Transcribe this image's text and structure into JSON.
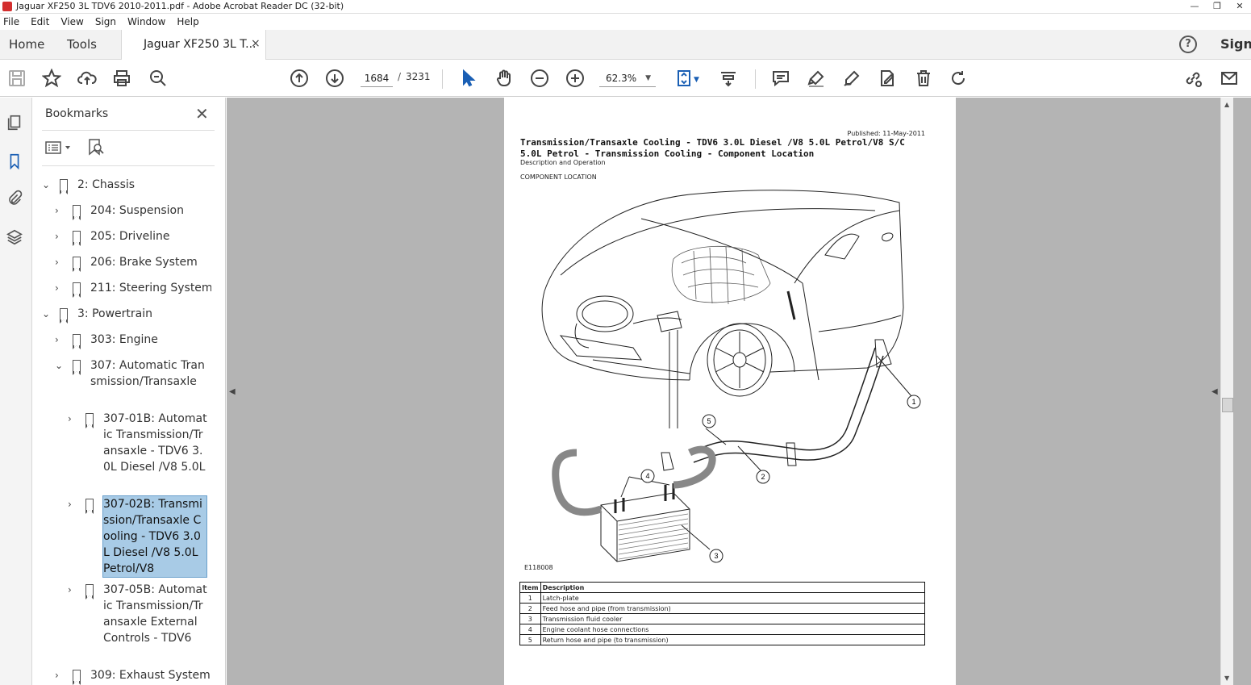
{
  "window": {
    "title": "Jaguar XF250 3L TDV6 2010-2011.pdf - Adobe Acrobat Reader DC (32-bit)",
    "buttons": [
      "—",
      "❐",
      "✕"
    ]
  },
  "menu": [
    "File",
    "Edit",
    "View",
    "Sign",
    "Window",
    "Help"
  ],
  "tabs": {
    "home": "Home",
    "tools": "Tools",
    "document": "Jaguar XF250 3L T...",
    "close": "×",
    "help": "?",
    "sign": "Sign"
  },
  "toolbar": {
    "current_page": "1684",
    "page_sep": "/",
    "total_pages": "3231",
    "zoom": "62.3%"
  },
  "bookmarks": {
    "header": "Bookmarks",
    "close": "✕",
    "items": [
      {
        "label": "2: Chassis",
        "expanded": true
      },
      {
        "label": "204: Suspension",
        "expanded": false
      },
      {
        "label": "205: Driveline",
        "expanded": false
      },
      {
        "label": "206: Brake System",
        "expanded": false
      },
      {
        "label": "211: Steering System",
        "expanded": false
      },
      {
        "label": "3: Powertrain",
        "expanded": true
      },
      {
        "label": "303: Engine",
        "expanded": false
      },
      {
        "label": "307: Automatic Transmission/Transaxle",
        "expanded": true
      },
      {
        "label": "307-01B: Automatic Transmission/Transaxle - TDV6 3.0L Diesel /V8 5.0L",
        "expanded": false
      },
      {
        "label": "307-02B: Transmission/Transaxle Cooling - TDV6 3.0L Diesel /V8 5.0L Petrol/V8",
        "expanded": false,
        "selected": true
      },
      {
        "label": "307-05B: Automatic Transmission/Transaxle External Controls - TDV6",
        "expanded": false
      },
      {
        "label": "309: Exhaust System",
        "expanded": false
      }
    ]
  },
  "page": {
    "published": "Published: 11-May-2011",
    "title": "Transmission/Transaxle Cooling - TDV6 3.0L Diesel /V8 5.0L Petrol/V8 S/C 5.0L Petrol - Transmission Cooling   - Component Location",
    "subtitle": "Description and Operation",
    "section": "COMPONENT LOCATION",
    "figure_id": "E118008",
    "callouts": [
      "1",
      "2",
      "3",
      "4",
      "5"
    ],
    "table": {
      "headers": [
        "Item",
        "Description"
      ],
      "rows": [
        [
          "1",
          "Latch-plate"
        ],
        [
          "2",
          "Feed hose and pipe (from transmission)"
        ],
        [
          "3",
          "Transmission fluid cooler"
        ],
        [
          "4",
          "Engine coolant hose connections"
        ],
        [
          "5",
          "Return hose and pipe (to transmission)"
        ]
      ]
    }
  },
  "colors": {
    "selection": "#a8cbe6",
    "doc_background": "#b4b4b4",
    "acrobat_red": "#d32f2f"
  }
}
